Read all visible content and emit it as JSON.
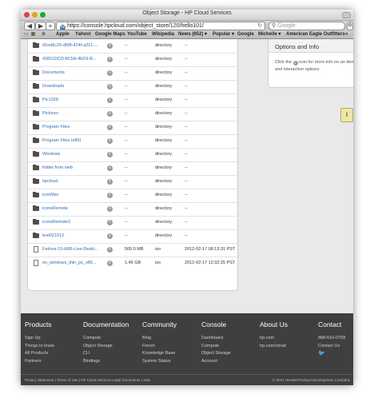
{
  "browser": {
    "title": "Object Storage - HP Cloud Services",
    "url": "https://console.hpcloud.com/object_store/120/hello101/",
    "search_placeholder": "Google",
    "nav_back": "◀",
    "nav_fwd": "▶",
    "add": "+",
    "bookmarks": [
      "Apple",
      "Yahoo!",
      "Google Maps",
      "YouTube",
      "Wikipedia",
      "News (652) ▾",
      "Popular ▾",
      "Google",
      "Michelle ▾",
      "American Eagle Outfitters"
    ],
    "more": "»"
  },
  "rows": [
    {
      "kind": "folder",
      "name": "41ed6c26-d5f8-424f-a311-...",
      "size": "--",
      "type": "directory",
      "modified": "--"
    },
    {
      "kind": "folder",
      "name": "43811DCD-8C5A-4EF9-B...",
      "size": "--",
      "type": "directory",
      "modified": "--"
    },
    {
      "kind": "folder",
      "name": "Documents",
      "size": "--",
      "type": "directory",
      "modified": "--"
    },
    {
      "kind": "folder",
      "name": "Downloads",
      "size": "--",
      "type": "directory",
      "modified": "--"
    },
    {
      "kind": "folder",
      "name": "Pic1028",
      "size": "--",
      "type": "directory",
      "modified": "--"
    },
    {
      "kind": "folder",
      "name": "Pictures",
      "size": "--",
      "type": "directory",
      "modified": "--"
    },
    {
      "kind": "folder",
      "name": "Program Files",
      "size": "--",
      "type": "directory",
      "modified": "--"
    },
    {
      "kind": "folder",
      "name": "Program Files (x86)",
      "size": "--",
      "type": "directory",
      "modified": "--"
    },
    {
      "kind": "folder",
      "name": "Windows",
      "size": "--",
      "type": "directory",
      "modified": "--"
    },
    {
      "kind": "folder",
      "name": "folder from web",
      "size": "--",
      "type": "directory",
      "modified": "--"
    },
    {
      "kind": "folder",
      "name": "hpcloud",
      "size": "--",
      "type": "directory",
      "modified": "--"
    },
    {
      "kind": "folder",
      "name": "iconMac",
      "size": "--",
      "type": "directory",
      "modified": "--"
    },
    {
      "kind": "folder",
      "name": "iconsRemote",
      "size": "--",
      "type": "directory",
      "modified": "--"
    },
    {
      "kind": "folder",
      "name": "iconsRemote2",
      "size": "--",
      "type": "directory",
      "modified": "--"
    },
    {
      "kind": "folder",
      "name": "test021512",
      "size": "--",
      "type": "directory",
      "modified": "--"
    },
    {
      "kind": "file",
      "name": "Fedora-15-i686-Live-Deskt...",
      "size": "565.0 MB",
      "type": "iso",
      "modified": "2012-02-17 08:13:31 PST"
    },
    {
      "kind": "file",
      "name": "en_windows_thin_pc_x86...",
      "size": "1.46 GB",
      "type": "iso",
      "modified": "2012-02-17 12:32:25 PST"
    }
  ],
  "panel": {
    "title": "Options and Info",
    "text_before": "Click the",
    "text_after": "icon for more info on an item and interaction options."
  },
  "help_label": "i",
  "footer": {
    "columns": [
      {
        "heading": "Products",
        "links": [
          "Sign Up",
          "Things to know",
          "All Products",
          "Partners"
        ]
      },
      {
        "heading": "Documentation",
        "links": [
          "Compute",
          "Object Storage",
          "CLI",
          "Bindings"
        ]
      },
      {
        "heading": "Community",
        "links": [
          "Blog",
          "Forum",
          "Knowledge Base",
          "System Status"
        ]
      },
      {
        "heading": "Console",
        "links": [
          "Dashboard",
          "Compute",
          "Object Storage",
          "Account"
        ]
      },
      {
        "heading": "About Us",
        "links": [
          "hp.com",
          "hp.com/cloud"
        ]
      },
      {
        "heading": "Contact",
        "links": [
          "888-616-0708",
          "Contact Us"
        ]
      }
    ],
    "bottom_left": "Privacy Statement | Terms of Use | HP Cloud Services Legal Documents | Jobs",
    "bottom_right": "© 2012 Hewlett-Packard Development Company"
  }
}
